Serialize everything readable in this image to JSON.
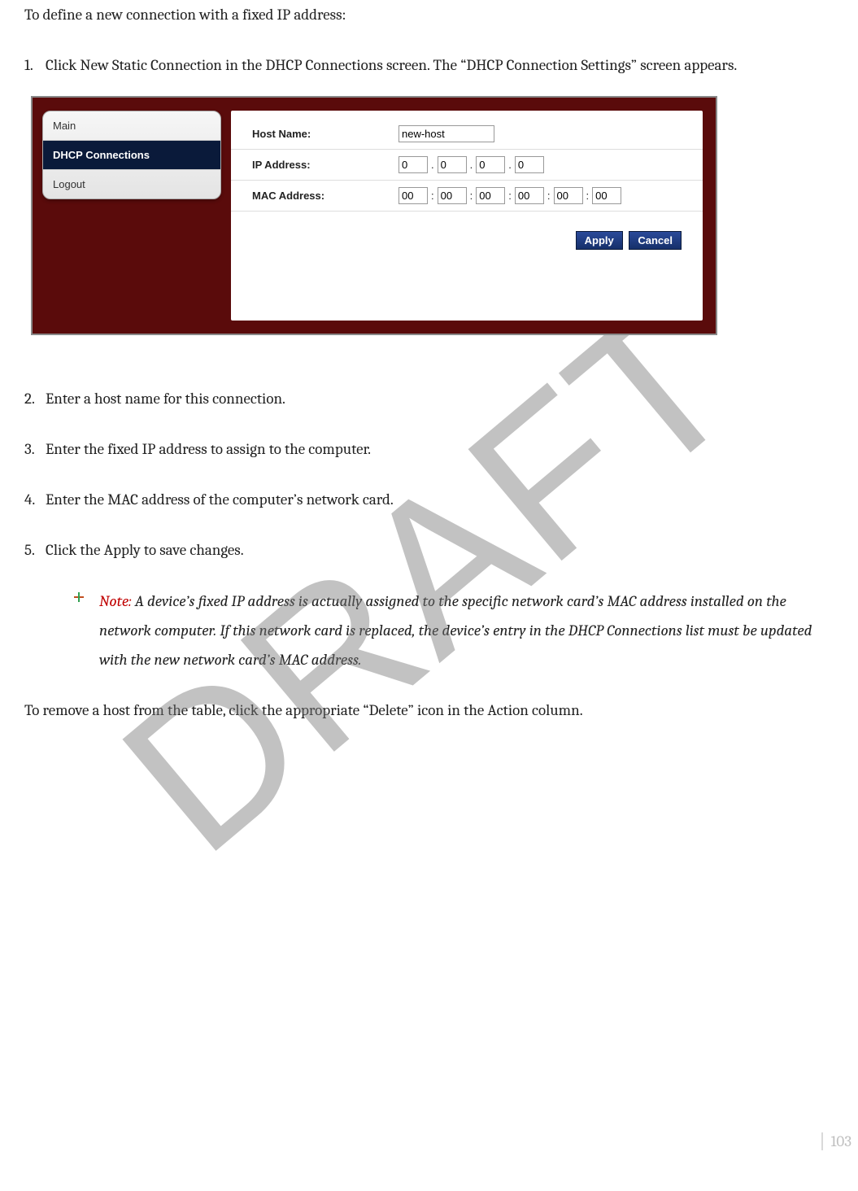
{
  "watermark": "DRAFT",
  "intro": "To define a new connection with a fixed IP address:",
  "steps": [
    "Click New Static Connection in the DHCP Connections screen. The “DHCP Connection Settings” screen appears.",
    "Enter a host name for this connection.",
    "Enter the fixed IP address to assign to the computer.",
    "Enter the MAC address of the computer’s network card.",
    "Click the Apply to save changes."
  ],
  "sidebar": {
    "items": [
      {
        "label": "Main",
        "active": false
      },
      {
        "label": "DHCP Connections",
        "active": true
      },
      {
        "label": "Logout",
        "active": false
      }
    ]
  },
  "form": {
    "hostLabel": "Host Name:",
    "hostValue": "new-host",
    "ipLabel": "IP Address:",
    "ipSep": ".",
    "ipOctets": [
      "0",
      "0",
      "0",
      "0"
    ],
    "macLabel": "MAC Address:",
    "macSep": ":",
    "macHex": [
      "00",
      "00",
      "00",
      "00",
      "00",
      "00"
    ],
    "applyLabel": "Apply",
    "cancelLabel": "Cancel"
  },
  "note": {
    "label": "Note:",
    "body": " A device’s fixed IP address is actually assigned to the specific network card’s MAC address installed on the network computer. If this network card is replaced, the device’s entry in the DHCP Connections list must be updated with the new network card’s MAC address."
  },
  "tail": "To remove a host from the table, click the appropriate “Delete” icon in the Action column.",
  "pageNumber": "103"
}
